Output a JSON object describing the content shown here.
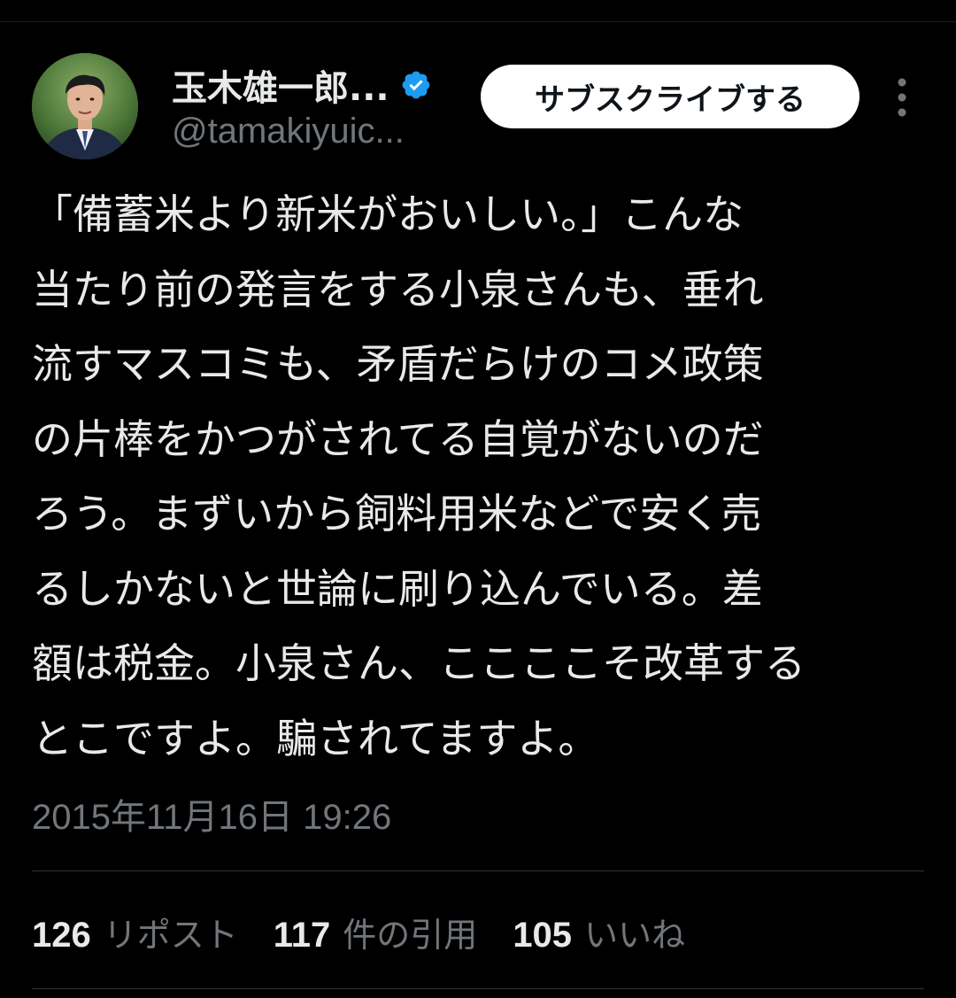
{
  "author": {
    "display_name": "玉木雄一郎...",
    "handle": "@tamakiyuic...",
    "verified": true
  },
  "actions": {
    "subscribe_label": "サブスクライブする"
  },
  "tweet": {
    "lines": [
      "「備蓄米より新米がおいしい。」こんな",
      "当たり前の発言をする小泉さんも、垂れ",
      "流すマスコミも、矛盾だらけのコメ政策",
      "の片棒をかつがされてる自覚がないのだ",
      "ろう。まずいから飼料用米などで安く売",
      "るしかないと世論に刷り込んでいる。差",
      "額は税金。小泉さん、ここここそ改革する",
      "とこですよ。騙されてますよ。"
    ],
    "timestamp": "2015年11月16日 19:26"
  },
  "stats": {
    "reposts_count": "126",
    "reposts_label": "リポスト",
    "quotes_count": "117",
    "quotes_label": "件の引用",
    "likes_count": "105",
    "likes_label": "いいね"
  },
  "icons": {
    "verified": "verified-badge-icon",
    "more": "more-vertical-icon"
  },
  "colors": {
    "background": "#000000",
    "text_primary": "#e7e9ea",
    "text_secondary": "#71767b",
    "verified_blue": "#1d9bf0",
    "button_bg": "#ffffff",
    "button_text": "#0f1419",
    "divider": "#2f3336"
  }
}
